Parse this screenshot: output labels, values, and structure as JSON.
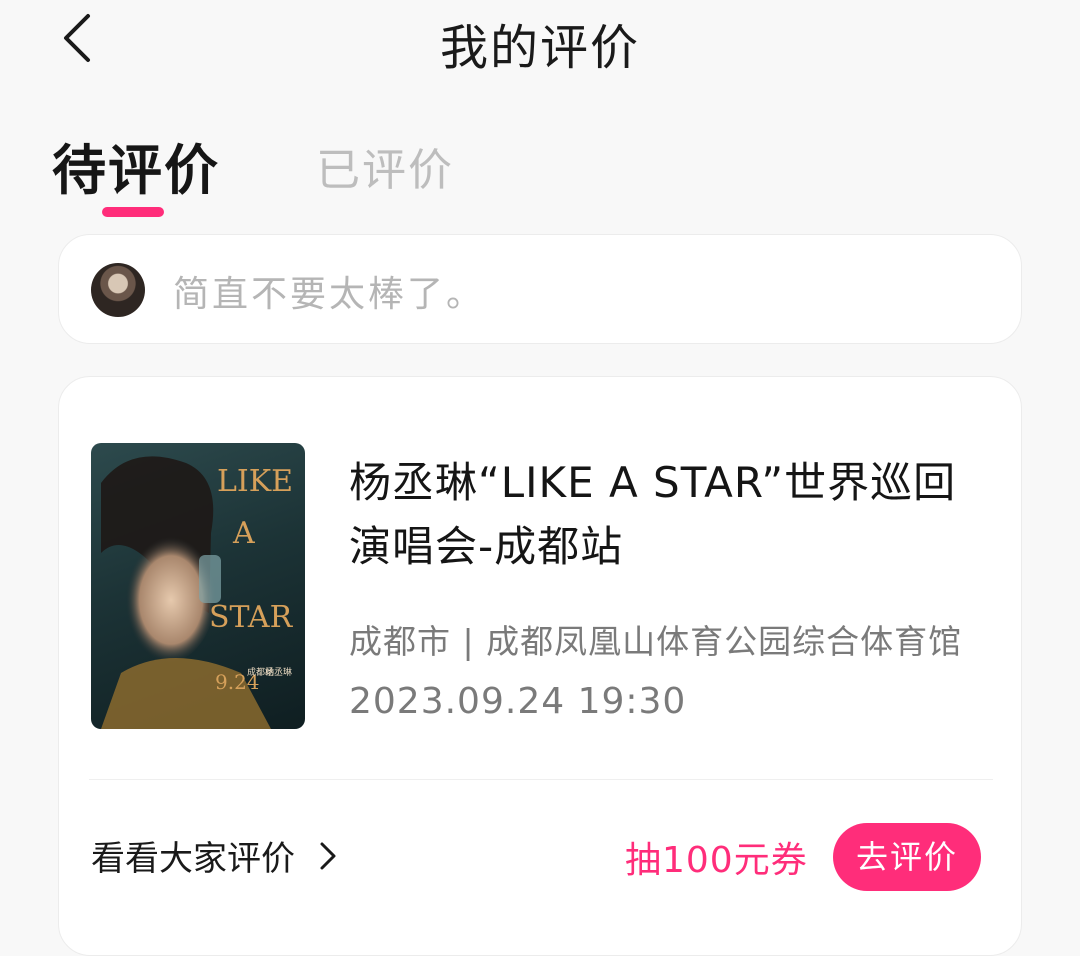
{
  "header": {
    "title": "我的评价"
  },
  "tabs": [
    {
      "label": "待评价",
      "active": true
    },
    {
      "label": "已评价",
      "active": false
    }
  ],
  "prompt": {
    "text": "简直不要太棒了。"
  },
  "order": {
    "title": "杨丞琳“LIKE A STAR”世界巡回演唱会-成都站",
    "venue": "成都市 | 成都凤凰山体育公园综合体育馆",
    "datetime": "2023.09.24 19:30",
    "see_all_label": "看看大家评价",
    "coupon_text": "抽100元券",
    "review_button_label": "去评价",
    "poster": {
      "text_like": "LIKE",
      "text_a": "A",
      "text_star": "STAR",
      "text_date": "9.24",
      "text_city": "成都站",
      "text_name": "杨丞琳"
    }
  },
  "colors": {
    "accent": "#ff2d7a",
    "background": "#f8f8f8",
    "card": "#ffffff",
    "muted_text": "#7a7a7a",
    "placeholder_text": "#b5b5b5"
  },
  "icons": {
    "back": "chevron-left-icon",
    "see_all": "chevron-right-icon"
  }
}
